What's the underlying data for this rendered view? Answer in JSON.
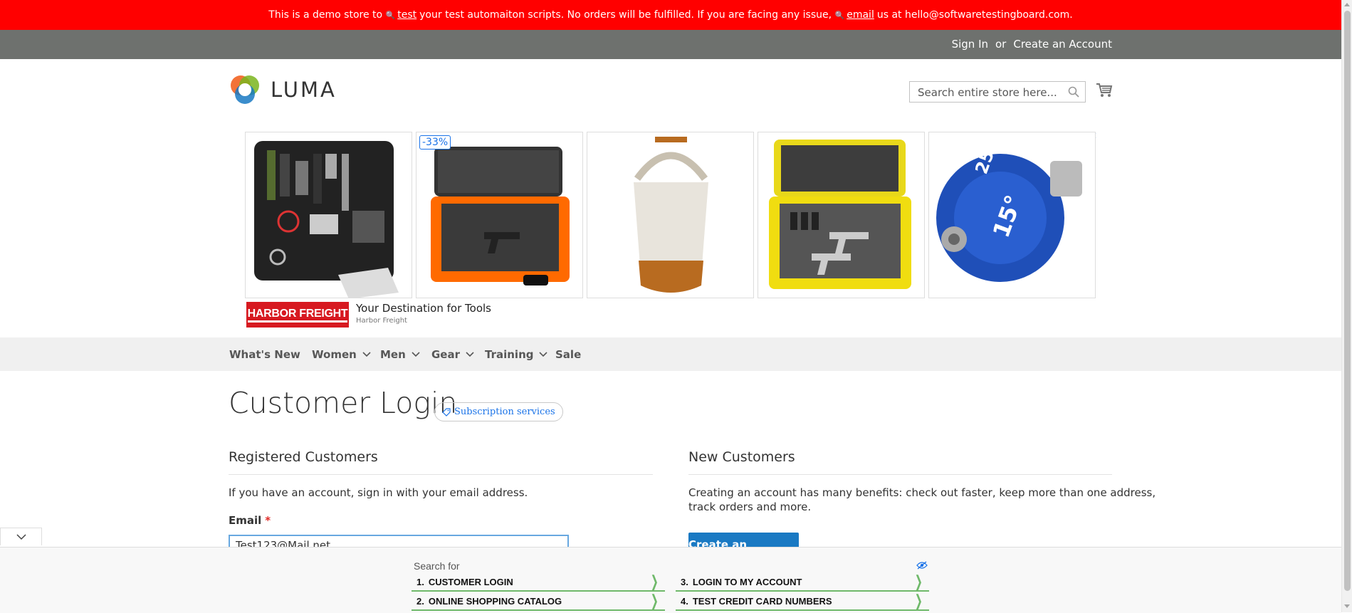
{
  "demo_banner": {
    "text_1": "This is a demo store to",
    "link_1": "test",
    "text_2": "your test automaiton scripts. No orders will be fulfilled. If you are facing any issue,",
    "link_2": "email",
    "text_3": "us at hello@softwaretestingboard.com."
  },
  "header": {
    "sign_in": "Sign In",
    "or": "or",
    "create_account": "Create an Account"
  },
  "logo": {
    "text": "LUMA"
  },
  "search": {
    "placeholder": "Search entire store here..."
  },
  "ad": {
    "discount": "-33%",
    "brand_logo": "HARBOR FREIGHT",
    "title": "Your Destination for Tools",
    "subtitle": "Harbor Freight"
  },
  "nav": {
    "items": [
      {
        "label": "What's New"
      },
      {
        "label": "Women"
      },
      {
        "label": "Men"
      },
      {
        "label": "Gear"
      },
      {
        "label": "Training"
      },
      {
        "label": "Sale"
      }
    ]
  },
  "main": {
    "title": "Customer Login",
    "subscription_badge": "Subscription services",
    "registered": {
      "title": "Registered Customers",
      "intro": "If you have an account, sign in with your email address.",
      "email_label": "Email",
      "required_mark": "*",
      "email_value": "Test123@Mail.net"
    },
    "new_customers": {
      "title": "New Customers",
      "intro_line1": "Creating an account has many benefits: check out faster, keep more than one address,",
      "intro_line2": "track orders and more.",
      "create_button": "Create an Account"
    }
  },
  "bottom_ad": {
    "search_for": "Search for",
    "links": [
      {
        "num": "1.",
        "label": "CUSTOMER LOGIN"
      },
      {
        "num": "3.",
        "label": "LOGIN TO MY ACCOUNT"
      },
      {
        "num": "2.",
        "label": "ONLINE SHOPPING CATALOG"
      },
      {
        "num": "4.",
        "label": "TEST CREDIT CARD NUMBERS"
      }
    ]
  },
  "colors": {
    "banner": "#ff0000",
    "panel": "#6e716e",
    "primary_button": "#1979c3",
    "link_blue": "#1a73e8",
    "ad_brand": "#d71920"
  }
}
